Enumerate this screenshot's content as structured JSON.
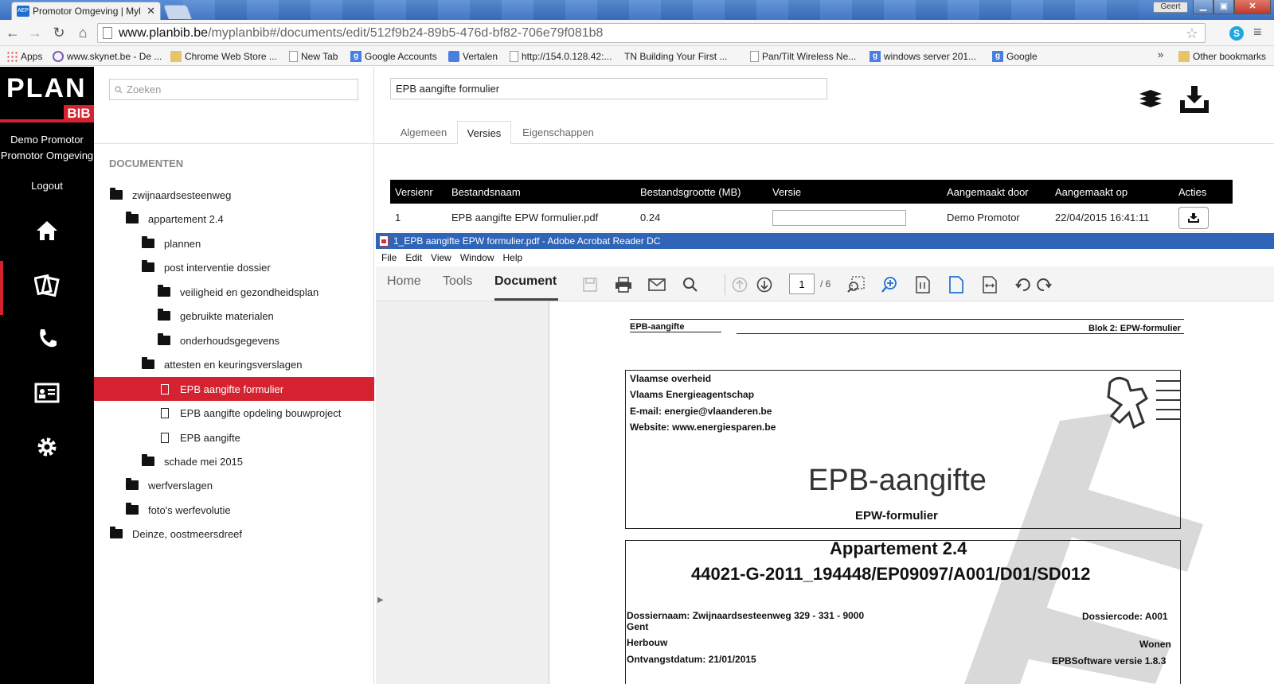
{
  "browser": {
    "tab_title": "Promotor Omgeving | Myl",
    "tab_favicon": "AEP",
    "user_chip": "Geert",
    "url_host": "www.planbib.be",
    "url_path": "/myplanbib#/documents/edit/512f9b24-89b5-476d-bf82-706e79f081b8",
    "bookmarks": [
      {
        "label": "Apps",
        "icon": "apps-icon"
      },
      {
        "label": "www.skynet.be - De ...",
        "icon": "skynet-icon"
      },
      {
        "label": "Chrome Web Store ...",
        "icon": "webstore-icon"
      },
      {
        "label": "New Tab",
        "icon": "page-icon"
      },
      {
        "label": "Google Accounts",
        "icon": "google-icon"
      },
      {
        "label": "Vertalen",
        "icon": "translate-icon"
      },
      {
        "label": "http://154.0.128.42:...",
        "icon": "page-icon"
      },
      {
        "label": "TN Building Your First ...",
        "icon": "page-icon"
      },
      {
        "label": "Pan/Tilt Wireless Ne...",
        "icon": "page-icon"
      },
      {
        "label": "windows server 201...",
        "icon": "google-icon"
      },
      {
        "label": "Google",
        "icon": "google-icon"
      }
    ],
    "bookmarks_more": "»",
    "other_bookmarks": "Other bookmarks"
  },
  "app": {
    "logo_plan": "PLAN",
    "logo_bib": "BIB",
    "user_name": "Demo Promotor",
    "user_org": "Promotor Omgeving",
    "logout": "Logout",
    "search_placeholder": "Zoeken",
    "section_title": "DOCUMENTEN",
    "tree": [
      {
        "label": "zwijnaardsesteenweg",
        "type": "folder",
        "level": 0
      },
      {
        "label": "appartement 2.4",
        "type": "folder",
        "level": 1
      },
      {
        "label": "plannen",
        "type": "folder",
        "level": 2
      },
      {
        "label": "post interventie dossier",
        "type": "folder",
        "level": 2
      },
      {
        "label": "veiligheid en gezondheidsplan",
        "type": "folder",
        "level": 3
      },
      {
        "label": "gebruikte materialen",
        "type": "folder",
        "level": 3
      },
      {
        "label": "onderhoudsgegevens",
        "type": "folder",
        "level": 3
      },
      {
        "label": "attesten en keuringsverslagen",
        "type": "folder",
        "level": 2
      },
      {
        "label": "EPB aangifte formulier",
        "type": "doc",
        "level": 3,
        "selected": true
      },
      {
        "label": "EPB aangifte opdeling bouwproject",
        "type": "doc",
        "level": 3
      },
      {
        "label": "EPB aangifte",
        "type": "doc",
        "level": 3
      },
      {
        "label": "schade mei 2015",
        "type": "folder",
        "level": 2
      },
      {
        "label": "werfverslagen",
        "type": "folder",
        "level": 1
      },
      {
        "label": "foto's werfevolutie",
        "type": "folder",
        "level": 1
      },
      {
        "label": "Deinze, oostmeersdreef",
        "type": "folder",
        "level": 0
      }
    ],
    "doc_title": "EPB aangifte formulier",
    "tabs": {
      "general": "Algemeen",
      "versions": "Versies",
      "properties": "Eigenschappen"
    },
    "table": {
      "headers": [
        "Versienr",
        "Bestandsnaam",
        "Bestandsgrootte (MB)",
        "Versie",
        "Aangemaakt door",
        "Aangemaakt op",
        "Acties"
      ],
      "rows": [
        {
          "nr": "1",
          "name": "EPB aangifte EPW formulier.pdf",
          "size": "0.24",
          "version": "",
          "by": "Demo Promotor",
          "on": "22/04/2015 16:41:11"
        }
      ]
    },
    "accent": "#d42230"
  },
  "acrobat": {
    "title": "1_EPB aangifte EPW formulier.pdf - Adobe Acrobat Reader DC",
    "menu": [
      "File",
      "Edit",
      "View",
      "Window",
      "Help"
    ],
    "tabs": {
      "home": "Home",
      "tools": "Tools",
      "document": "Document"
    },
    "page_current": "1",
    "page_total": "/ 6",
    "pdf": {
      "hdr_left": "EPB-aangifte",
      "hdr_right": "Blok 2: EPW-formulier",
      "org1": "Vlaamse overheid",
      "org2": "Vlaams Energieagentschap",
      "email": "E-mail: energie@vlaanderen.be",
      "website": "Website: www.energiesparen.be",
      "big_title": "EPB-aangifte",
      "sub_title": "EPW-formulier",
      "app_title": "Appartement 2.4",
      "app_code": "44021-G-2011_194448/EP09097/A001/D01/SD012",
      "dossiernaam": "Dossiernaam: Zwijnaardsesteenweg 329 - 331 - 9000",
      "dossiernaam2": "Gent",
      "dossiercode": "Dossiercode: A001",
      "herbouw": "Herbouw",
      "wonen": "Wonen",
      "ontvang": "Ontvangstdatum: 21/01/2015",
      "software": "EPBSoftware versie 1.8.3"
    }
  }
}
